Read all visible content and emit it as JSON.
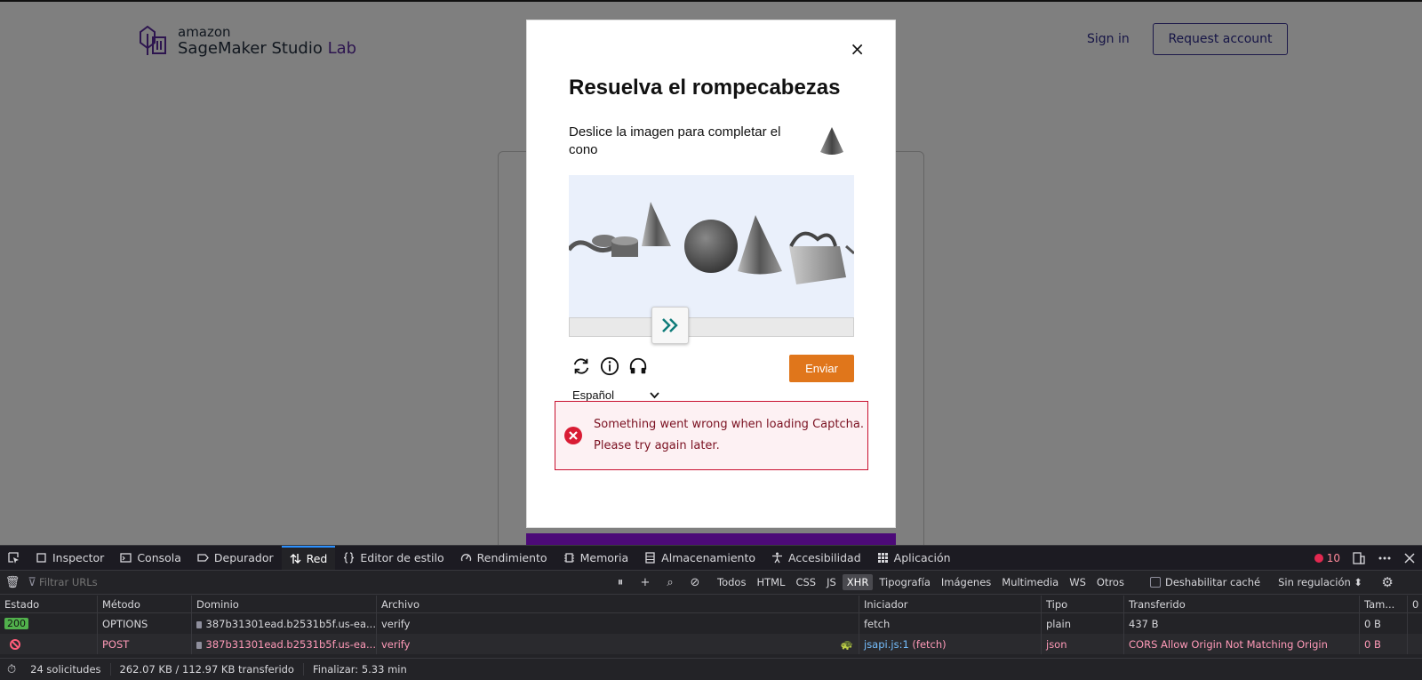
{
  "page": {
    "logo_small": "amazon",
    "logo_main": "SageMaker Studio ",
    "logo_accent": "Lab",
    "signin_label": "Sign in",
    "request_label": "Request account"
  },
  "captcha": {
    "title": "Resuelva el rompecabezas",
    "instruction": "Deslice la imagen para completar el cono",
    "close_symbol": "×",
    "submit_label": "Enviar",
    "language": "Español",
    "error_message": "Something went wrong when loading Captcha. Please try again later.",
    "icons": [
      "refresh-icon",
      "info-icon",
      "headphones-icon"
    ]
  },
  "devtools": {
    "tabs": [
      "Inspector",
      "Consola",
      "Depurador",
      "Red",
      "Editor de estilo",
      "Rendimiento",
      "Memoria",
      "Almacenamiento",
      "Accesibilidad",
      "Aplicación"
    ],
    "active_tab": "Red",
    "error_count": "10",
    "filter_placeholder": "Filtrar URLs",
    "type_filters": [
      "Todos",
      "HTML",
      "CSS",
      "JS",
      "XHR",
      "Tipografía",
      "Imágenes",
      "Multimedia",
      "WS",
      "Otros"
    ],
    "selected_type": "XHR",
    "disable_cache_label": "Deshabilitar caché",
    "throttle_label": "Sin regulación",
    "columns": [
      "Estado",
      "Método",
      "Dominio",
      "Archivo",
      "Iniciador",
      "Tipo",
      "Transferido",
      "Tam...",
      "0"
    ],
    "rows": [
      {
        "status": "200",
        "method": "OPTIONS",
        "domain": "387b31301ead.b2531b5f.us-ea...",
        "file": "verify",
        "initiator": "fetch",
        "initiator_extra": "",
        "type": "plain",
        "transferred": "437 B",
        "size": "0 B"
      },
      {
        "status": "blocked",
        "method": "POST",
        "domain": "387b31301ead.b2531b5f.us-ea...",
        "file": "verify",
        "initiator": "jsapi.js:1",
        "initiator_extra": " (fetch)",
        "type": "json",
        "transferred": "CORS Allow Origin Not Matching Origin",
        "size": "0 B"
      }
    ],
    "summary": {
      "requests": "24 solicitudes",
      "transferred": "262.07 KB / 112.97 KB transferido",
      "finish": "Finalizar: 5.33 min"
    }
  }
}
